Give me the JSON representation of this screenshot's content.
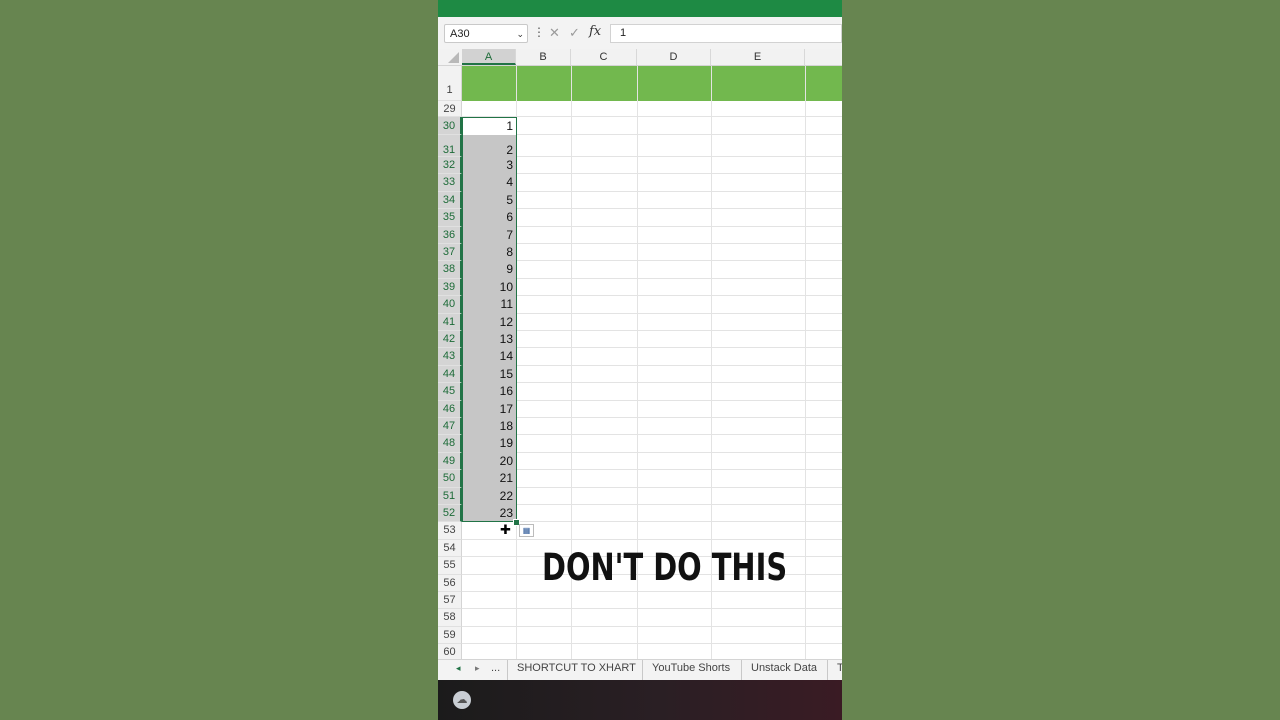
{
  "formula_bar": {
    "name_box": "A30",
    "name_box_arrow": "⌄",
    "menu_dots": "⋮",
    "cancel_glyph": "✕",
    "enter_glyph": "✓",
    "fx_label": "fx",
    "value": "1"
  },
  "columns": [
    "A",
    "B",
    "C",
    "D",
    "E"
  ],
  "rows": [
    {
      "num": "1",
      "value": ""
    },
    {
      "num": "29",
      "value": ""
    },
    {
      "num": "30",
      "value": "1"
    },
    {
      "num": "31",
      "value": "2"
    },
    {
      "num": "32",
      "value": "3"
    },
    {
      "num": "33",
      "value": "4"
    },
    {
      "num": "34",
      "value": "5"
    },
    {
      "num": "35",
      "value": "6"
    },
    {
      "num": "36",
      "value": "7"
    },
    {
      "num": "37",
      "value": "8"
    },
    {
      "num": "38",
      "value": "9"
    },
    {
      "num": "39",
      "value": "10"
    },
    {
      "num": "40",
      "value": "11"
    },
    {
      "num": "41",
      "value": "12"
    },
    {
      "num": "42",
      "value": "13"
    },
    {
      "num": "43",
      "value": "14"
    },
    {
      "num": "44",
      "value": "15"
    },
    {
      "num": "45",
      "value": "16"
    },
    {
      "num": "46",
      "value": "17"
    },
    {
      "num": "47",
      "value": "18"
    },
    {
      "num": "48",
      "value": "19"
    },
    {
      "num": "49",
      "value": "20"
    },
    {
      "num": "50",
      "value": "21"
    },
    {
      "num": "51",
      "value": "22"
    },
    {
      "num": "52",
      "value": "23"
    },
    {
      "num": "53",
      "value": ""
    },
    {
      "num": "54",
      "value": ""
    },
    {
      "num": "55",
      "value": ""
    },
    {
      "num": "56",
      "value": ""
    },
    {
      "num": "57",
      "value": ""
    },
    {
      "num": "58",
      "value": ""
    },
    {
      "num": "59",
      "value": ""
    },
    {
      "num": "60",
      "value": ""
    }
  ],
  "caption": "DON'T DO THIS",
  "sheet_tabs": {
    "nav_prev": "◂",
    "nav_next": "▸",
    "more": "...",
    "tabs": [
      "SHORTCUT TO XHART",
      "YouTube Shorts",
      "Unstack Data",
      "T"
    ]
  },
  "colors": {
    "accent": "#217346",
    "banner": "#72b84e",
    "top_bar": "#1e8a44",
    "background": "#678550",
    "selection": "#c6c6c6"
  },
  "icons": {
    "cursor": "crosshair-plus-icon",
    "autofill": "autofill-options-icon",
    "weather": "weather-icon"
  }
}
